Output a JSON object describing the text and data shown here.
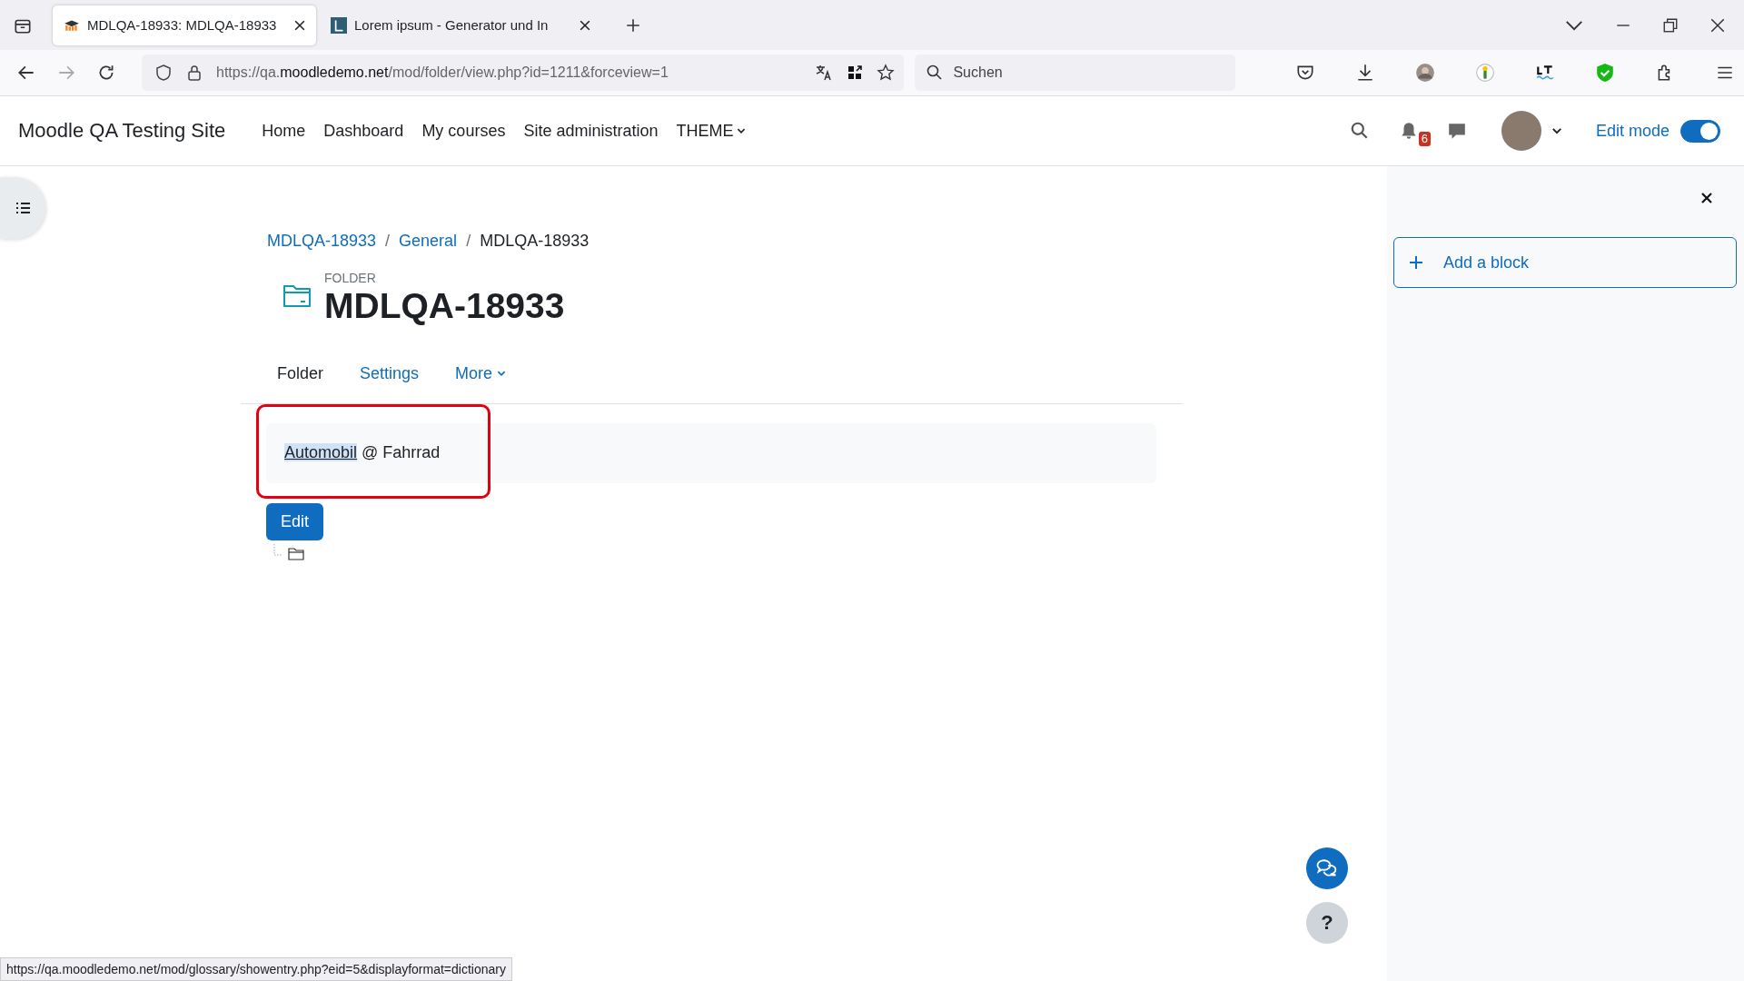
{
  "browser": {
    "tabs": [
      {
        "title": "MDLQA-18933: MDLQA-18933",
        "selected": true,
        "kind": "moodle"
      },
      {
        "title": "Lorem ipsum - Generator und In",
        "selected": false,
        "kind": "letter"
      }
    ],
    "url": "https://qa.**moodledemo.net**/mod/folder/view.php?id=1211&forceview=1",
    "search": {
      "placeholder": "Suchen"
    }
  },
  "site": {
    "name": "Moodle QA Testing Site",
    "nav": [
      {
        "label": "Home",
        "dropdown": false
      },
      {
        "label": "Dashboard",
        "dropdown": false
      },
      {
        "label": "My courses",
        "dropdown": false
      },
      {
        "label": "Site administration",
        "dropdown": false
      },
      {
        "label": "THEME",
        "dropdown": true
      }
    ],
    "notifications": "6",
    "edit_mode": {
      "label": "Edit mode",
      "on": true
    }
  },
  "breadcrumb": {
    "separator": "/",
    "items": [
      {
        "label": "MDLQA-18933",
        "link": true
      },
      {
        "label": "General",
        "link": true
      },
      {
        "label": "MDLQA-18933",
        "link": false
      }
    ]
  },
  "page": {
    "kind_label": "FOLDER",
    "title": "MDLQA-18933",
    "tabs": [
      {
        "label": "Folder",
        "selected": true,
        "dropdown": false
      },
      {
        "label": "Settings",
        "selected": false,
        "dropdown": false
      },
      {
        "label": "More",
        "selected": false,
        "dropdown": true
      }
    ],
    "intro": {
      "link": "Automobil",
      "link_selected": true,
      "rest": "@ Fahrrad"
    },
    "edit_button": "Edit"
  },
  "drawer": {
    "add_block": "Add a block"
  },
  "help": {
    "label": "?"
  },
  "status_bar": "https://qa.moodledemo.net/mod/glossary/showentry.php?eid=5&displayformat=dictionary"
}
